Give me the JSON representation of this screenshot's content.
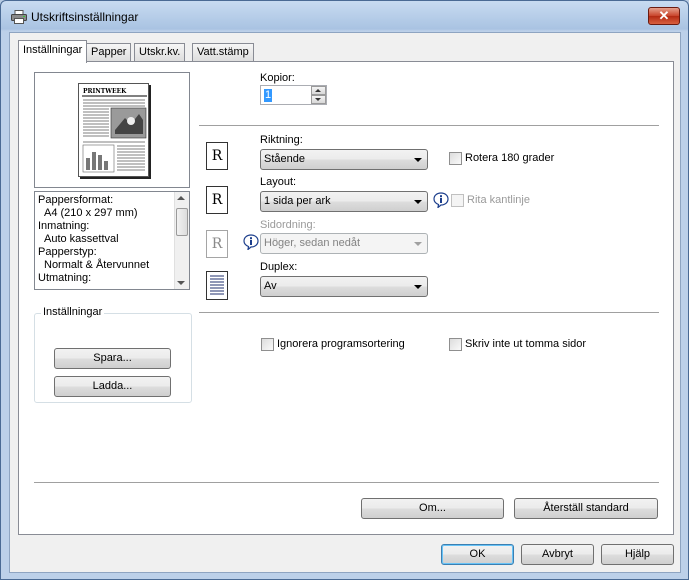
{
  "window": {
    "title": "Utskriftsinställningar",
    "close_label": "✕",
    "icon": "printer-icon"
  },
  "tabs": [
    {
      "label": "Inställningar",
      "active": true
    },
    {
      "label": "Papper",
      "active": false
    },
    {
      "label": "Utskr.kv.",
      "active": false
    },
    {
      "label": "Vatt.stämp",
      "active": false
    }
  ],
  "preview": {
    "newspaper_title": "PRINTWEEK"
  },
  "summary": {
    "lines": [
      {
        "text": "Pappersformat:",
        "indent": false
      },
      {
        "text": "A4 (210 x 297 mm)",
        "indent": true
      },
      {
        "text": "Inmatning:",
        "indent": false
      },
      {
        "text": "Auto kassettval",
        "indent": true
      },
      {
        "text": "Papperstyp:",
        "indent": false
      },
      {
        "text": "Normalt & Återvunnet",
        "indent": true
      },
      {
        "text": "Utmatning:",
        "indent": false
      }
    ]
  },
  "settings_group": {
    "legend": "Inställningar",
    "save_label": "Spara...",
    "load_label": "Ladda..."
  },
  "copies": {
    "label": "Kopior:",
    "value": "1"
  },
  "orientation": {
    "label": "Riktning:",
    "value": "Stående",
    "rotate_label": "Rotera 180 grader",
    "rotate_checked": false
  },
  "layout": {
    "label": "Layout:",
    "value": "1 sida per ark",
    "border_label": "Rita kantlinje",
    "border_checked": false,
    "border_enabled": false
  },
  "page_order": {
    "label": "Sidordning:",
    "value": "Höger, sedan nedåt",
    "enabled": false
  },
  "duplex": {
    "label": "Duplex:",
    "value": "Av"
  },
  "collate": {
    "label": "Ignorera programsortering",
    "checked": false
  },
  "skip_blank": {
    "label": "Skriv inte ut tomma sidor",
    "checked": false
  },
  "panel_buttons": {
    "about_label": "Om...",
    "reset_label": "Återställ standard"
  },
  "dialog_buttons": {
    "ok_label": "OK",
    "cancel_label": "Avbryt",
    "help_label": "Hjälp"
  },
  "orientation_glyph": "R",
  "colors": {
    "accent": "#3399ff",
    "title_gradient_top": "#c8dbf1",
    "close_red": "#c8432a"
  }
}
